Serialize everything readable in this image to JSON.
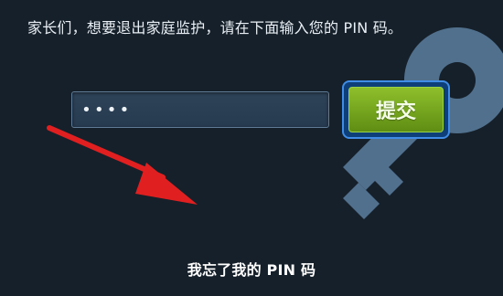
{
  "page": {
    "instruction": "家长们，想要退出家庭监护，请在下面输入您的 PIN 码。"
  },
  "pin": {
    "value": "••••"
  },
  "actions": {
    "submit_label": "提交",
    "forgot_pin_label": "我忘了我的 PIN 码"
  },
  "theme": {
    "background": "#15202a",
    "accent_green": "#7fb21f",
    "focus_blue": "#3f8de6",
    "arrow_red": "#e02020"
  },
  "decor": {
    "background_icon": "key-icon",
    "annotation_icon": "red-arrow-icon"
  }
}
